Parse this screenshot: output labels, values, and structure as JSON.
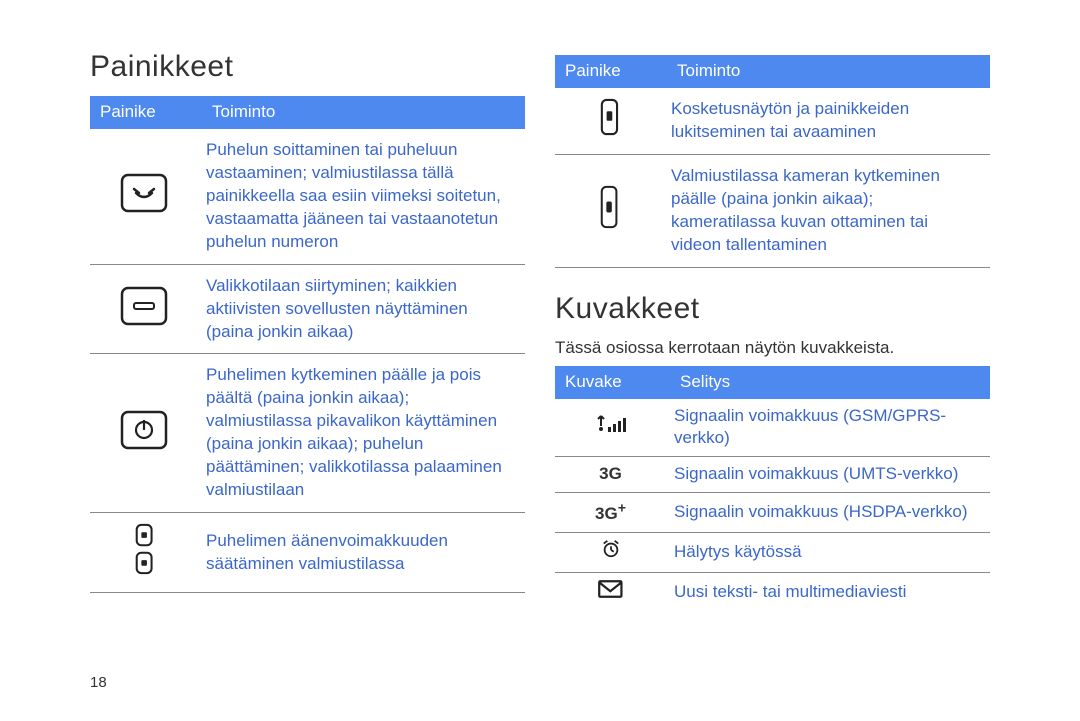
{
  "page_number": "18",
  "left": {
    "heading": "Painikkeet",
    "table_headers": [
      "Painike",
      "Toiminto"
    ],
    "rows": [
      {
        "icon": "call-button",
        "text": "Puhelun soittaminen tai puheluun vastaaminen; valmiustilassa tällä painikkeella saa esiin viimeksi soitetun, vastaamatta jääneen tai vastaanotetun puhelun numeron"
      },
      {
        "icon": "menu-button",
        "text": "Valikkotilaan siirtyminen; kaikkien aktiivisten sovellusten näyttäminen (paina jonkin aikaa)"
      },
      {
        "icon": "power-button",
        "text": "Puhelimen kytkeminen päälle ja pois päältä (paina jonkin aikaa); valmiustilassa pikavalikon käyttäminen (paina jonkin aikaa); puhelun päättäminen; valikkotilassa palaaminen valmiustilaan"
      },
      {
        "icon": "volume-button",
        "text": "Puhelimen äänenvoimakkuuden säätäminen valmiustilassa"
      }
    ]
  },
  "right_top": {
    "table_headers": [
      "Painike",
      "Toiminto"
    ],
    "rows": [
      {
        "icon": "lock-button",
        "text": "Kosketusnäytön ja painikkeiden lukitseminen tai avaaminen"
      },
      {
        "icon": "camera-button",
        "text": "Valmiustilassa kameran kytkeminen päälle (paina jonkin aikaa); kameratilassa kuvan ottaminen tai videon tallentaminen"
      }
    ]
  },
  "right_bottom": {
    "heading": "Kuvakkeet",
    "intro": "Tässä osiossa kerrotaan näytön kuvakkeista.",
    "table_headers": [
      "Kuvake",
      "Selitys"
    ],
    "rows": [
      {
        "icon": "signal-gsm",
        "text": "Signaalin voimakkuus (GSM/GPRS-verkko)"
      },
      {
        "icon": "signal-3g",
        "text": "Signaalin voimakkuus (UMTS-verkko)"
      },
      {
        "icon": "signal-3gplus",
        "text": "Signaalin voimakkuus (HSDPA-verkko)"
      },
      {
        "icon": "alarm",
        "text": "Hälytys käytössä"
      },
      {
        "icon": "message",
        "text": "Uusi teksti- tai multimediaviesti"
      }
    ]
  }
}
